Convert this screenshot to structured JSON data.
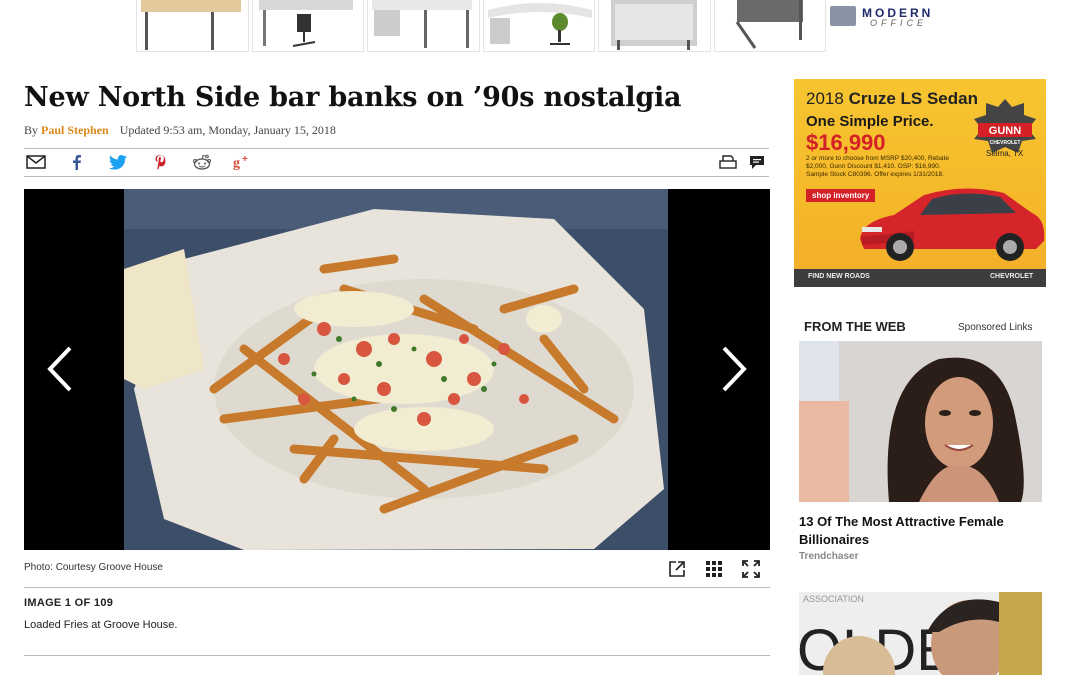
{
  "top_ad": {
    "thumbnails": [
      "desk-1",
      "desk-2",
      "desk-3",
      "desk-4",
      "desk-5",
      "desk-6"
    ],
    "brand_line1": "MODERN",
    "brand_line2": "OFFICE"
  },
  "article": {
    "headline": "New North Side bar banks on ’90s nostalgia",
    "by_prefix": "By",
    "author": "Paul Stephen",
    "updated": "Updated 9:53 am, Monday, January 15, 2018",
    "share_icons": [
      "email-icon",
      "facebook-icon",
      "twitter-icon",
      "pinterest-icon",
      "reddit-icon",
      "google-plus-icon"
    ],
    "tool_icons": [
      "print-icon",
      "comment-icon"
    ]
  },
  "slideshow": {
    "photo_credit": "Photo: Courtesy Groove House",
    "counter": "IMAGE 1 OF 109",
    "description": "Loaded Fries at Groove House.",
    "tools": [
      "share-out-icon",
      "grid-icon",
      "fullscreen-icon"
    ]
  },
  "car_ad": {
    "year": "2018",
    "model": "Cruze LS Sedan",
    "headline": "One Simple Price.",
    "price": "$16,990",
    "fine_print": "2 or more to choose from MSRP $20,400, Rebate $2,000, Gunn Discount $1,410. OSP: $16,990. Sample Stock C80396. Offer expires 1/31/2018.",
    "button": "shop inventory",
    "dealer": "GUNN",
    "dealer_sub": "CHEVROLET",
    "city": "Selma, TX",
    "footer_left": "FIND NEW ROADS",
    "footer_right": "CHEVROLET",
    "colors": {
      "background": "#f5b82a",
      "price": "#d42027"
    }
  },
  "from_the_web": {
    "title": "FROM THE WEB",
    "sponsored": "Sponsored Links",
    "item_title": "13 Of The Most Attractive Female Billionaires",
    "item_source": "Trendchaser",
    "second_item_overlay": "ASSOCIATION"
  },
  "colors": {
    "author": "#d88a1a",
    "headline": "#111111"
  }
}
